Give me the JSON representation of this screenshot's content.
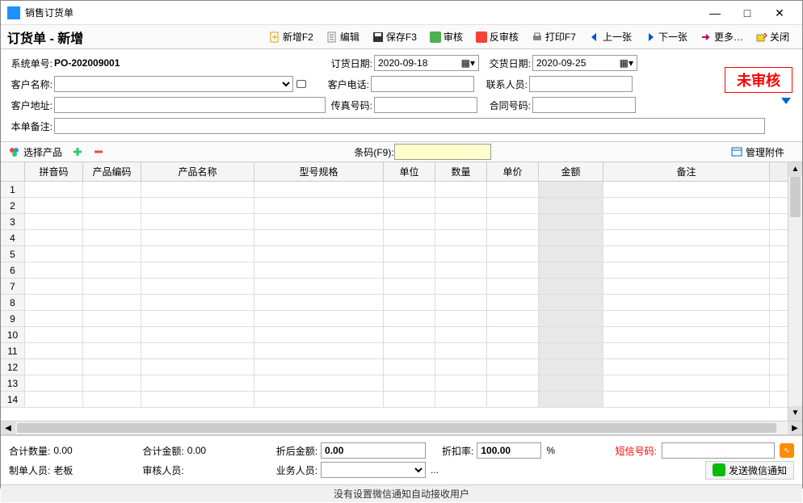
{
  "window": {
    "title": "销售订货单",
    "min": "—",
    "max": "□",
    "close": "✕"
  },
  "page": {
    "title": "订货单 - 新增"
  },
  "toolbar": {
    "new": "新增F2",
    "edit": "编辑",
    "save": "保存F3",
    "audit": "审核",
    "unaudit": "反审核",
    "print": "打印F7",
    "prev": "上一张",
    "next": "下一张",
    "more": "更多…",
    "close": "关闭"
  },
  "form": {
    "sys_no_label": "系统单号:",
    "sys_no": "PO-202009001",
    "order_date_label": "订货日期:",
    "order_date": "2020-09-18",
    "delivery_date_label": "交货日期:",
    "delivery_date": "2020-09-25",
    "cust_name_label": "客户名称:",
    "cust_name": "",
    "cust_tel_label": "客户电话:",
    "cust_tel": "",
    "contact_label": "联系人员:",
    "contact": "",
    "cust_addr_label": "客户地址:",
    "cust_addr": "",
    "fax_label": "传真号码:",
    "fax": "",
    "contract_label": "合同号码:",
    "contract": "",
    "remark_label": "本单备注:",
    "remark": "",
    "status": "未审核"
  },
  "subtoolbar": {
    "select_product": "选择产品",
    "barcode_label": "条码(F9):",
    "attachments": "管理附件"
  },
  "grid": {
    "headers": {
      "rn": "",
      "py": "拼音码",
      "code": "产品编码",
      "name": "产品名称",
      "spec": "型号规格",
      "unit": "单位",
      "qty": "数量",
      "price": "单价",
      "amount": "金额",
      "remark": "备注"
    },
    "rows": [
      1,
      2,
      3,
      4,
      5,
      6,
      7,
      8,
      9,
      10,
      11,
      12,
      13,
      14
    ]
  },
  "footer": {
    "total_qty_label": "合计数量:",
    "total_qty": "0.00",
    "total_amount_label": "合计金额:",
    "total_amount": "0.00",
    "after_discount_label": "折后金额:",
    "after_discount": "0.00",
    "discount_rate_label": "折扣率:",
    "discount_rate": "100.00",
    "pct": "%",
    "sms_label": "短信号码:",
    "maker_label": "制单人员:",
    "maker": "老板",
    "auditor_label": "审核人员:",
    "auditor": "",
    "salesman_label": "业务人员:",
    "salesman_more": "...",
    "wx_send": "发送微信通知"
  },
  "status_bar": "没有设置微信通知自动接收用户"
}
